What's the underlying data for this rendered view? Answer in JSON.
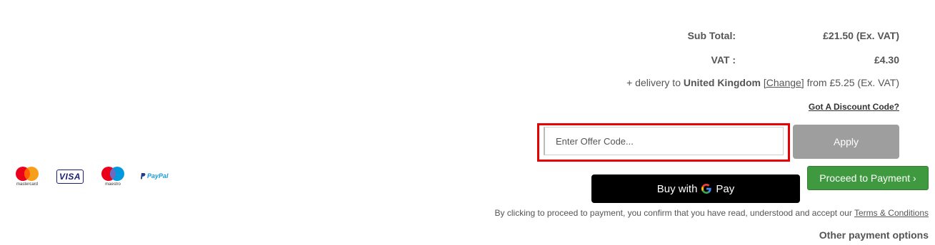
{
  "summary": {
    "subtotal_label": "Sub Total:",
    "subtotal_value": "£21.50 (Ex. VAT)",
    "vat_label": "VAT :",
    "vat_value": "£4.30"
  },
  "delivery": {
    "prefix": "+ delivery to",
    "country": "United Kingdom",
    "change_link": "[Change]",
    "suffix": "from £5.25 (Ex. VAT)"
  },
  "discount": {
    "link_label": "Got A Discount Code?",
    "placeholder": "Enter Offer Code...",
    "apply_label": "Apply"
  },
  "payment": {
    "gpay_prefix": "Buy with",
    "gpay_brand": "Pay",
    "proceed_label": "Proceed to Payment ›",
    "terms_text": "By clicking to proceed to payment, you confirm that you have read, understood and accept our",
    "terms_link": "Terms & Conditions",
    "other_options": "Other payment options"
  },
  "card_logos": {
    "mastercard": "mastercard",
    "visa": "VISA",
    "maestro": "maestro",
    "paypal": "PayPal"
  },
  "colors": {
    "accent_green": "#3f9a3f",
    "highlight_red": "#e60000",
    "apply_gray": "#9e9e9e"
  }
}
